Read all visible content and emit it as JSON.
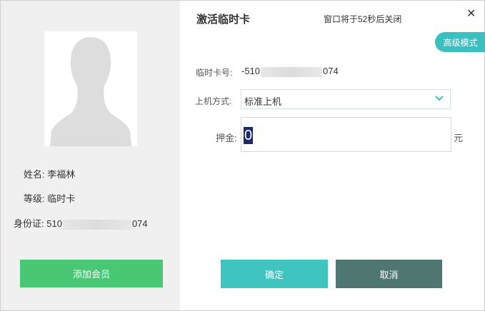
{
  "dialog": {
    "title": "激活临时卡",
    "countdown": "窗口将于52秒后关闭",
    "close_symbol": "✕",
    "advanced_mode": "高级模式"
  },
  "member": {
    "name_label": "姓名:",
    "name": "李福林",
    "level_label": "等级:",
    "level": "临时卡",
    "id_label": "身份证:",
    "id_prefix": "510",
    "id_suffix": "074",
    "add_member_button": "添加会员"
  },
  "form": {
    "card_label": "临时卡号:",
    "card_prefix": "-510",
    "card_suffix": "074",
    "mode_label": "上机方式:",
    "mode_value": "标准上机",
    "deposit_label": "押金:",
    "deposit_value": "0",
    "deposit_unit": "元"
  },
  "actions": {
    "confirm": "确定",
    "cancel": "取消"
  },
  "colors": {
    "accent_teal": "#40c4c0",
    "add_green": "#48c774",
    "cancel_slate": "#4f7671"
  }
}
